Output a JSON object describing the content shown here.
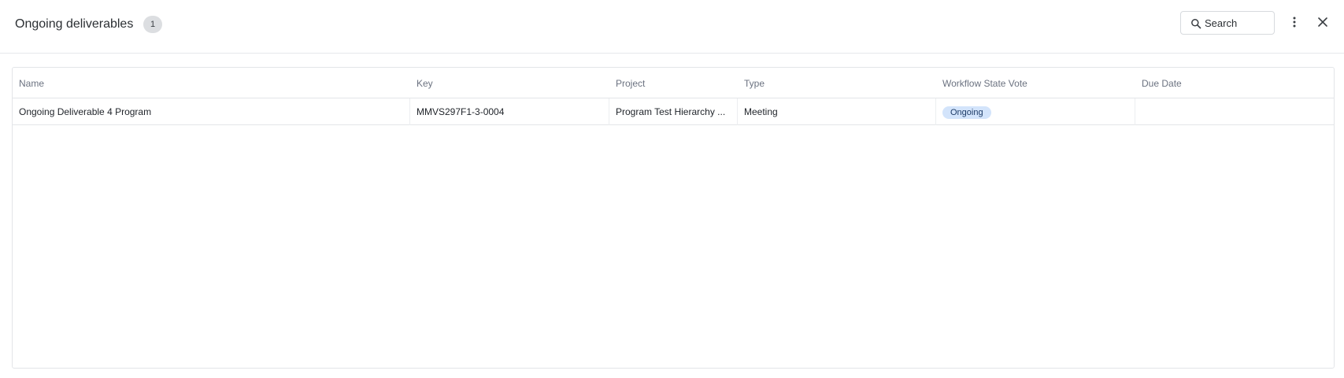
{
  "header": {
    "title": "Ongoing deliverables",
    "count": "1",
    "search_label": "Search"
  },
  "table": {
    "columns": [
      "Name",
      "Key",
      "Project",
      "Type",
      "Workflow State Vote",
      "Due Date"
    ],
    "rows": [
      {
        "name": "Ongoing Deliverable 4 Program",
        "key": "MMVS297F1-3-0004",
        "project": "Program Test Hierarchy ...",
        "type": "Meeting",
        "workflow_state": "Ongoing",
        "due_date": ""
      }
    ]
  },
  "icons": {
    "search": "search-icon",
    "more": "more-vertical-icon",
    "close": "close-icon"
  },
  "colors": {
    "status_pill_bg": "#d3e4fb",
    "count_badge_bg": "#dcdee1"
  }
}
